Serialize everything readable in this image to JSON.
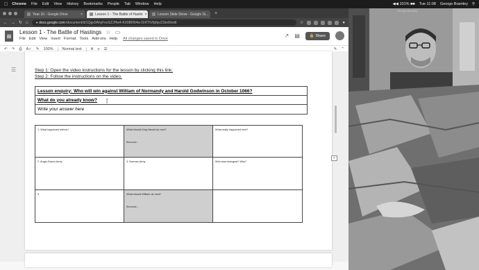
{
  "menubar": {
    "app": "Chrome",
    "items": [
      "File",
      "Edit",
      "View",
      "History",
      "Bookmarks",
      "People",
      "Tab",
      "Window",
      "Help"
    ],
    "status": "◀◀ 101% ■■",
    "clock": "Tue 11:08",
    "user": "George Bramley"
  },
  "tabs": [
    {
      "label": "Year 10 - Google Drive"
    },
    {
      "label": "Lesson 1 - The Battle of Hastin"
    },
    {
      "label": "Lesson Slide Show - Google Sl..."
    }
  ],
  "address": {
    "host": "docs.google.com",
    "path": "/document/d/1Qgx0AhyFnoSZJHw4-KX08KN4w-DrKTtVfpfqvZ2bn8/edit"
  },
  "doc": {
    "title": "Lesson 1 - The Battle of Hastings",
    "menu": [
      "File",
      "Edit",
      "View",
      "Insert",
      "Format",
      "Tools",
      "Add-ons",
      "Help"
    ],
    "saved": "All changes saved in Drive",
    "share": "Share",
    "toolbar": {
      "zoom": "100%",
      "style": "Normal text"
    },
    "ruler": "1 · 2 · 3 · 4 · 5 · 6 · 7 · 8 · 9 · 10 · 11 · 12 · 13 · 14 · 15 · 16 · 17 · 18 · 19 · 20 · 21 · 22 · 23 · 24 · 25 · 26 · 27 · 28"
  },
  "content": {
    "step1": "Step 1: Open the video instructions for the lesson by clicking this link:",
    "step2": "Step 2: Follow the instructions on the video.",
    "enquiry": "Lesson enquiry: Who will win against William of Normandy and Harold Godwinson in October 1066?",
    "already_know": "What do you already know?",
    "answer_placeholder": "Write your answer here",
    "grid": [
      {
        "head": "1. What happened before?",
        "body": ""
      },
      {
        "head": "What should King Harold do next?",
        "body": "Because..."
      },
      {
        "head": "What really happened next?",
        "body": ""
      },
      {
        "head": "2. Anglo-Saxon Army",
        "body": ""
      },
      {
        "head": "3. Norman Army",
        "body": ""
      },
      {
        "head": "Who was strongest? Why?",
        "body": ""
      },
      {
        "head": "3.",
        "body": ""
      },
      {
        "head": "What should William do next?",
        "body": "Because..."
      },
      {
        "head": "",
        "body": ""
      }
    ]
  },
  "video": {
    "label": "George Bramley"
  }
}
